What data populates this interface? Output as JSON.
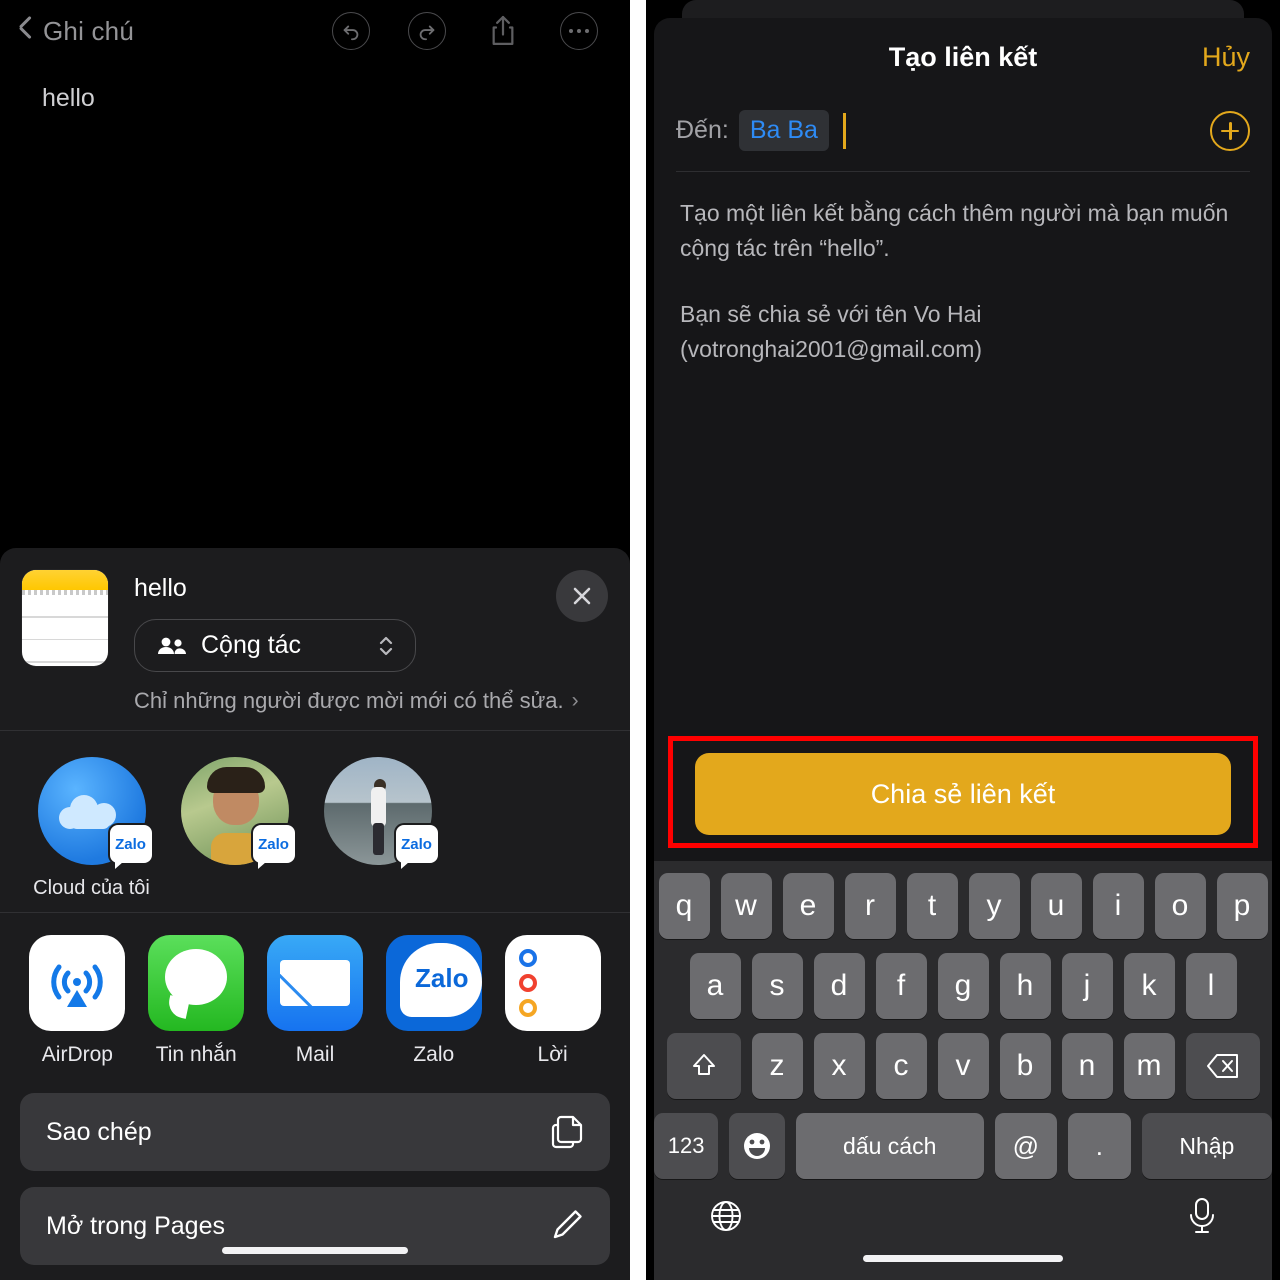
{
  "left": {
    "nav": {
      "back_label": "Ghi chú",
      "icons": [
        "back-chevron-icon",
        "undo-icon",
        "redo-icon",
        "share-icon",
        "more-icon"
      ]
    },
    "note": {
      "text": "hello"
    },
    "share_sheet": {
      "doc_title": "hello",
      "collab_option": "Cộng tác",
      "permission_text": "Chỉ những người được mời mới có thể sửa.",
      "close_label": "✕",
      "contacts": [
        {
          "name": "Cloud của tôi",
          "badge": "Zalo",
          "avatar": "icloud-avatar"
        },
        {
          "name": "",
          "badge": "Zalo",
          "avatar": "girl-photo-avatar"
        },
        {
          "name": "",
          "badge": "Zalo",
          "avatar": "man-photo-avatar"
        }
      ],
      "apps": [
        {
          "name": "AirDrop",
          "icon": "airdrop-icon"
        },
        {
          "name": "Tin nhắn",
          "icon": "messages-icon"
        },
        {
          "name": "Mail",
          "icon": "mail-icon"
        },
        {
          "name": "Zalo",
          "icon": "zalo-icon",
          "logo_text": "Zalo"
        },
        {
          "name": "Lời",
          "icon": "reminders-icon"
        }
      ],
      "actions": [
        {
          "label": "Sao chép",
          "icon": "copy-icon"
        },
        {
          "label": "Mở trong Pages",
          "icon": "markup-pencil-icon"
        }
      ]
    }
  },
  "right": {
    "sheet": {
      "title": "Tạo liên kết",
      "cancel_label": "Hủy",
      "to_label": "Đến:",
      "to_token": "Ba Ba",
      "add_button_label": "+",
      "description_1": "Tạo một liên kết bằng cách thêm người mà bạn muốn cộng tác trên “hello”.",
      "description_2": "Bạn sẽ chia sẻ với tên Vo Hai (votronghai2001@gmail.com)",
      "share_button_label": "Chia sẻ liên kết"
    },
    "keyboard": {
      "row1": [
        "q",
        "w",
        "e",
        "r",
        "t",
        "y",
        "u",
        "i",
        "o",
        "p"
      ],
      "row2": [
        "a",
        "s",
        "d",
        "f",
        "g",
        "h",
        "j",
        "k",
        "l"
      ],
      "row3": [
        "z",
        "x",
        "c",
        "v",
        "b",
        "n",
        "m"
      ],
      "shift_label": "⇧",
      "backspace_label": "⌫",
      "numbers_label": "123",
      "emoji_label": "☺",
      "space_label": "dấu cách",
      "at_label": "@",
      "period_label": ".",
      "enter_label": "Nhập",
      "globe_label": "globe-icon",
      "mic_label": "mic-icon"
    }
  },
  "colors": {
    "accent_yellow": "#e3a81c",
    "highlight_red": "#ff0000",
    "token_blue": "#2e8bf5",
    "sheet_bg": "#1c1c1e",
    "key_bg": "#6c6c6f"
  }
}
